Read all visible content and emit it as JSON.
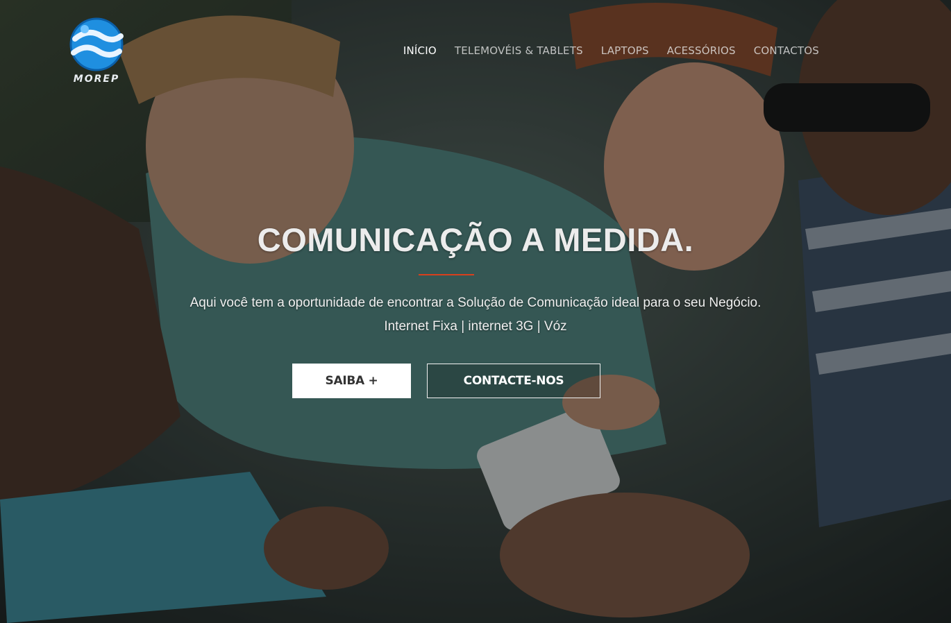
{
  "brand": {
    "name": "MOREP",
    "logo_icon": "globe-wave-icon",
    "accent": "#2a9de3"
  },
  "nav": {
    "items": [
      {
        "label": "INÍCIO",
        "active": true
      },
      {
        "label": "TELEMOVÉIS & TABLETS",
        "active": false
      },
      {
        "label": "LAPTOPS",
        "active": false
      },
      {
        "label": "ACESSÓRIOS",
        "active": false
      },
      {
        "label": "CONTACTOS",
        "active": false
      }
    ]
  },
  "hero": {
    "title": "COMUNICAÇÃO A MEDIDA.",
    "subtitle": "Aqui você tem a oportunidade de encontrar a Solução de Comunicação ideal para o seu Negócio.",
    "services": "Internet Fixa | internet 3G | Vóz",
    "primary_button": "SAIBA +",
    "secondary_button": "CONTACTE-NOS",
    "divider_color": "#d9401c"
  }
}
